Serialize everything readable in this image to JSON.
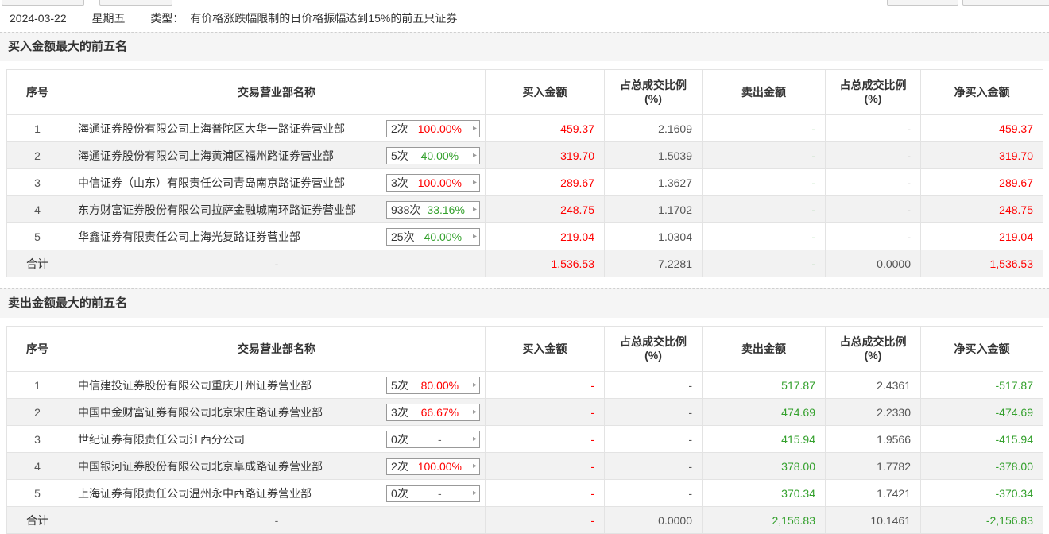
{
  "colors": {
    "red": "#ff0000",
    "green": "#33a02c",
    "gray": "#555555",
    "dash_gray": "#666666",
    "text": "#333333"
  },
  "icons": {
    "arrow": "▸"
  },
  "topbar": {
    "date": "2024-03-22",
    "weekday": "星期五",
    "type_label": "类型：",
    "type_value": "有价格涨跌幅限制的日价格振幅达到15%的前五只证券"
  },
  "headers": {
    "seq": "序号",
    "name": "交易营业部名称",
    "buy": "买入金额",
    "ratio_line1": "占总成交比例",
    "ratio_line2": "(%)",
    "sell": "卖出金额",
    "net": "净买入金额"
  },
  "buy": {
    "title": "买入金额最大的前五名",
    "rows": [
      {
        "seq": "1",
        "name": "海通证券股份有限公司上海普陀区大华一路证券营业部",
        "times": "2次",
        "pct": "100.00%",
        "pct_color": "#ff0000",
        "buy": "459.37",
        "buy_ratio": "2.1609",
        "sell": "-",
        "sell_ratio": "-",
        "net": "459.37"
      },
      {
        "seq": "2",
        "name": "海通证券股份有限公司上海黄浦区福州路证券营业部",
        "times": "5次",
        "pct": "40.00%",
        "pct_color": "#33a02c",
        "buy": "319.70",
        "buy_ratio": "1.5039",
        "sell": "-",
        "sell_ratio": "-",
        "net": "319.70"
      },
      {
        "seq": "3",
        "name": "中信证券（山东）有限责任公司青岛南京路证券营业部",
        "times": "3次",
        "pct": "100.00%",
        "pct_color": "#ff0000",
        "buy": "289.67",
        "buy_ratio": "1.3627",
        "sell": "-",
        "sell_ratio": "-",
        "net": "289.67"
      },
      {
        "seq": "4",
        "name": "东方财富证券股份有限公司拉萨金融城南环路证券营业部",
        "times": "938次",
        "pct": "33.16%",
        "pct_color": "#33a02c",
        "buy": "248.75",
        "buy_ratio": "1.1702",
        "sell": "-",
        "sell_ratio": "-",
        "net": "248.75"
      },
      {
        "seq": "5",
        "name": "华鑫证券有限责任公司上海光复路证券营业部",
        "times": "25次",
        "pct": "40.00%",
        "pct_color": "#33a02c",
        "buy": "219.04",
        "buy_ratio": "1.0304",
        "sell": "-",
        "sell_ratio": "-",
        "net": "219.04"
      }
    ],
    "total": {
      "seq": "合计",
      "name": "-",
      "buy": "1,536.53",
      "buy_ratio": "7.2281",
      "sell": "-",
      "sell_ratio": "0.0000",
      "net": "1,536.53"
    }
  },
  "sell": {
    "title": "卖出金额最大的前五名",
    "rows": [
      {
        "seq": "1",
        "name": "中信建投证券股份有限公司重庆开州证券营业部",
        "times": "5次",
        "pct": "80.00%",
        "pct_color": "#ff0000",
        "buy": "-",
        "buy_ratio": "-",
        "sell": "517.87",
        "sell_ratio": "2.4361",
        "net": "-517.87"
      },
      {
        "seq": "2",
        "name": "中国中金财富证券有限公司北京宋庄路证券营业部",
        "times": "3次",
        "pct": "66.67%",
        "pct_color": "#ff0000",
        "buy": "-",
        "buy_ratio": "-",
        "sell": "474.69",
        "sell_ratio": "2.2330",
        "net": "-474.69"
      },
      {
        "seq": "3",
        "name": "世纪证券有限责任公司江西分公司",
        "times": "0次",
        "pct": "-",
        "pct_color": "#666666",
        "buy": "-",
        "buy_ratio": "-",
        "sell": "415.94",
        "sell_ratio": "1.9566",
        "net": "-415.94"
      },
      {
        "seq": "4",
        "name": "中国银河证券股份有限公司北京阜成路证券营业部",
        "times": "2次",
        "pct": "100.00%",
        "pct_color": "#ff0000",
        "buy": "-",
        "buy_ratio": "-",
        "sell": "378.00",
        "sell_ratio": "1.7782",
        "net": "-378.00"
      },
      {
        "seq": "5",
        "name": "上海证券有限责任公司温州永中西路证券营业部",
        "times": "0次",
        "pct": "-",
        "pct_color": "#666666",
        "buy": "-",
        "buy_ratio": "-",
        "sell": "370.34",
        "sell_ratio": "1.7421",
        "net": "-370.34"
      }
    ],
    "total": {
      "seq": "合计",
      "name": "-",
      "buy": "-",
      "buy_ratio": "0.0000",
      "sell": "2,156.83",
      "sell_ratio": "10.1461",
      "net": "-2,156.83"
    }
  }
}
